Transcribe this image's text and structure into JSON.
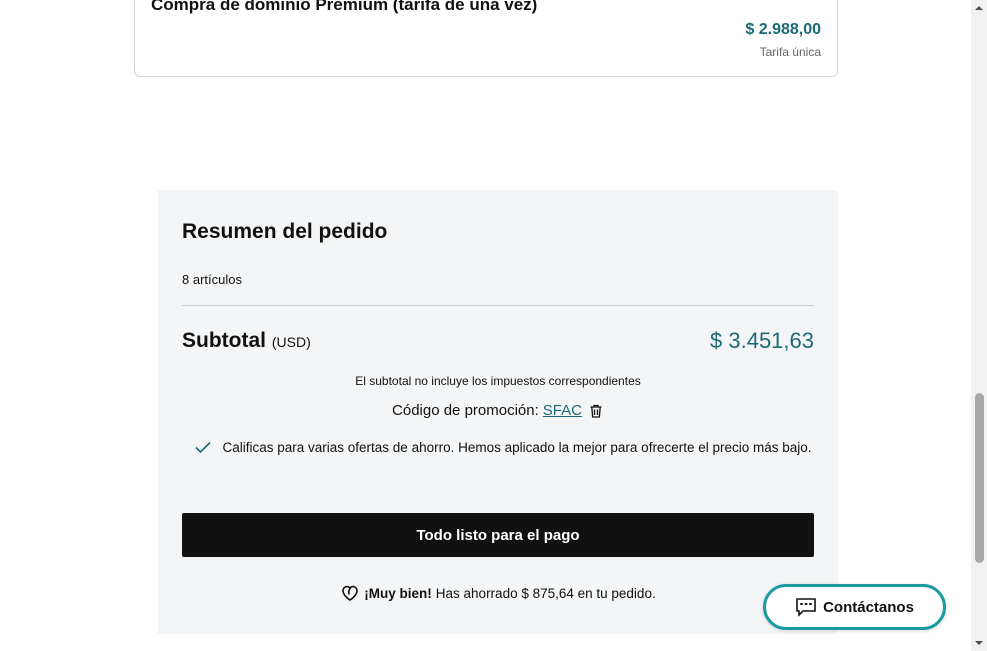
{
  "product_card": {
    "title": "Compra de dominio Premium (tarifa de una vez)",
    "price": "$ 2.988,00",
    "note": "Tarifa única"
  },
  "summary": {
    "title": "Resumen del pedido",
    "item_count": "8 artículos",
    "subtotal_label": "Subtotal",
    "subtotal_currency": "(USD)",
    "subtotal_value": "$ 3.451,63",
    "tax_note": "El subtotal no incluye los impuestos correspondientes",
    "promo_label": "Código de promoción:",
    "promo_code": "SFAC",
    "offer_text": "Calificas para varias ofertas de ahorro. Hemos aplicado la mejor para ofrecerte el precio más bajo.",
    "pay_button": "Todo listo para el pago",
    "saved_prefix": "¡Muy bien!",
    "saved_text": "Has ahorrado $ 875,64 en tu pedido."
  },
  "contact_button": {
    "label": "Contáctanos"
  },
  "icons": {
    "promo_remove": "trash-icon",
    "offer": "check-icon",
    "savings": "heart-icon",
    "contact": "chat-icon"
  },
  "colors": {
    "accent": "#1b6b77",
    "button_bg": "#111111",
    "panel_bg": "#f4f5f6",
    "contact_border": "#1b9aa0"
  }
}
